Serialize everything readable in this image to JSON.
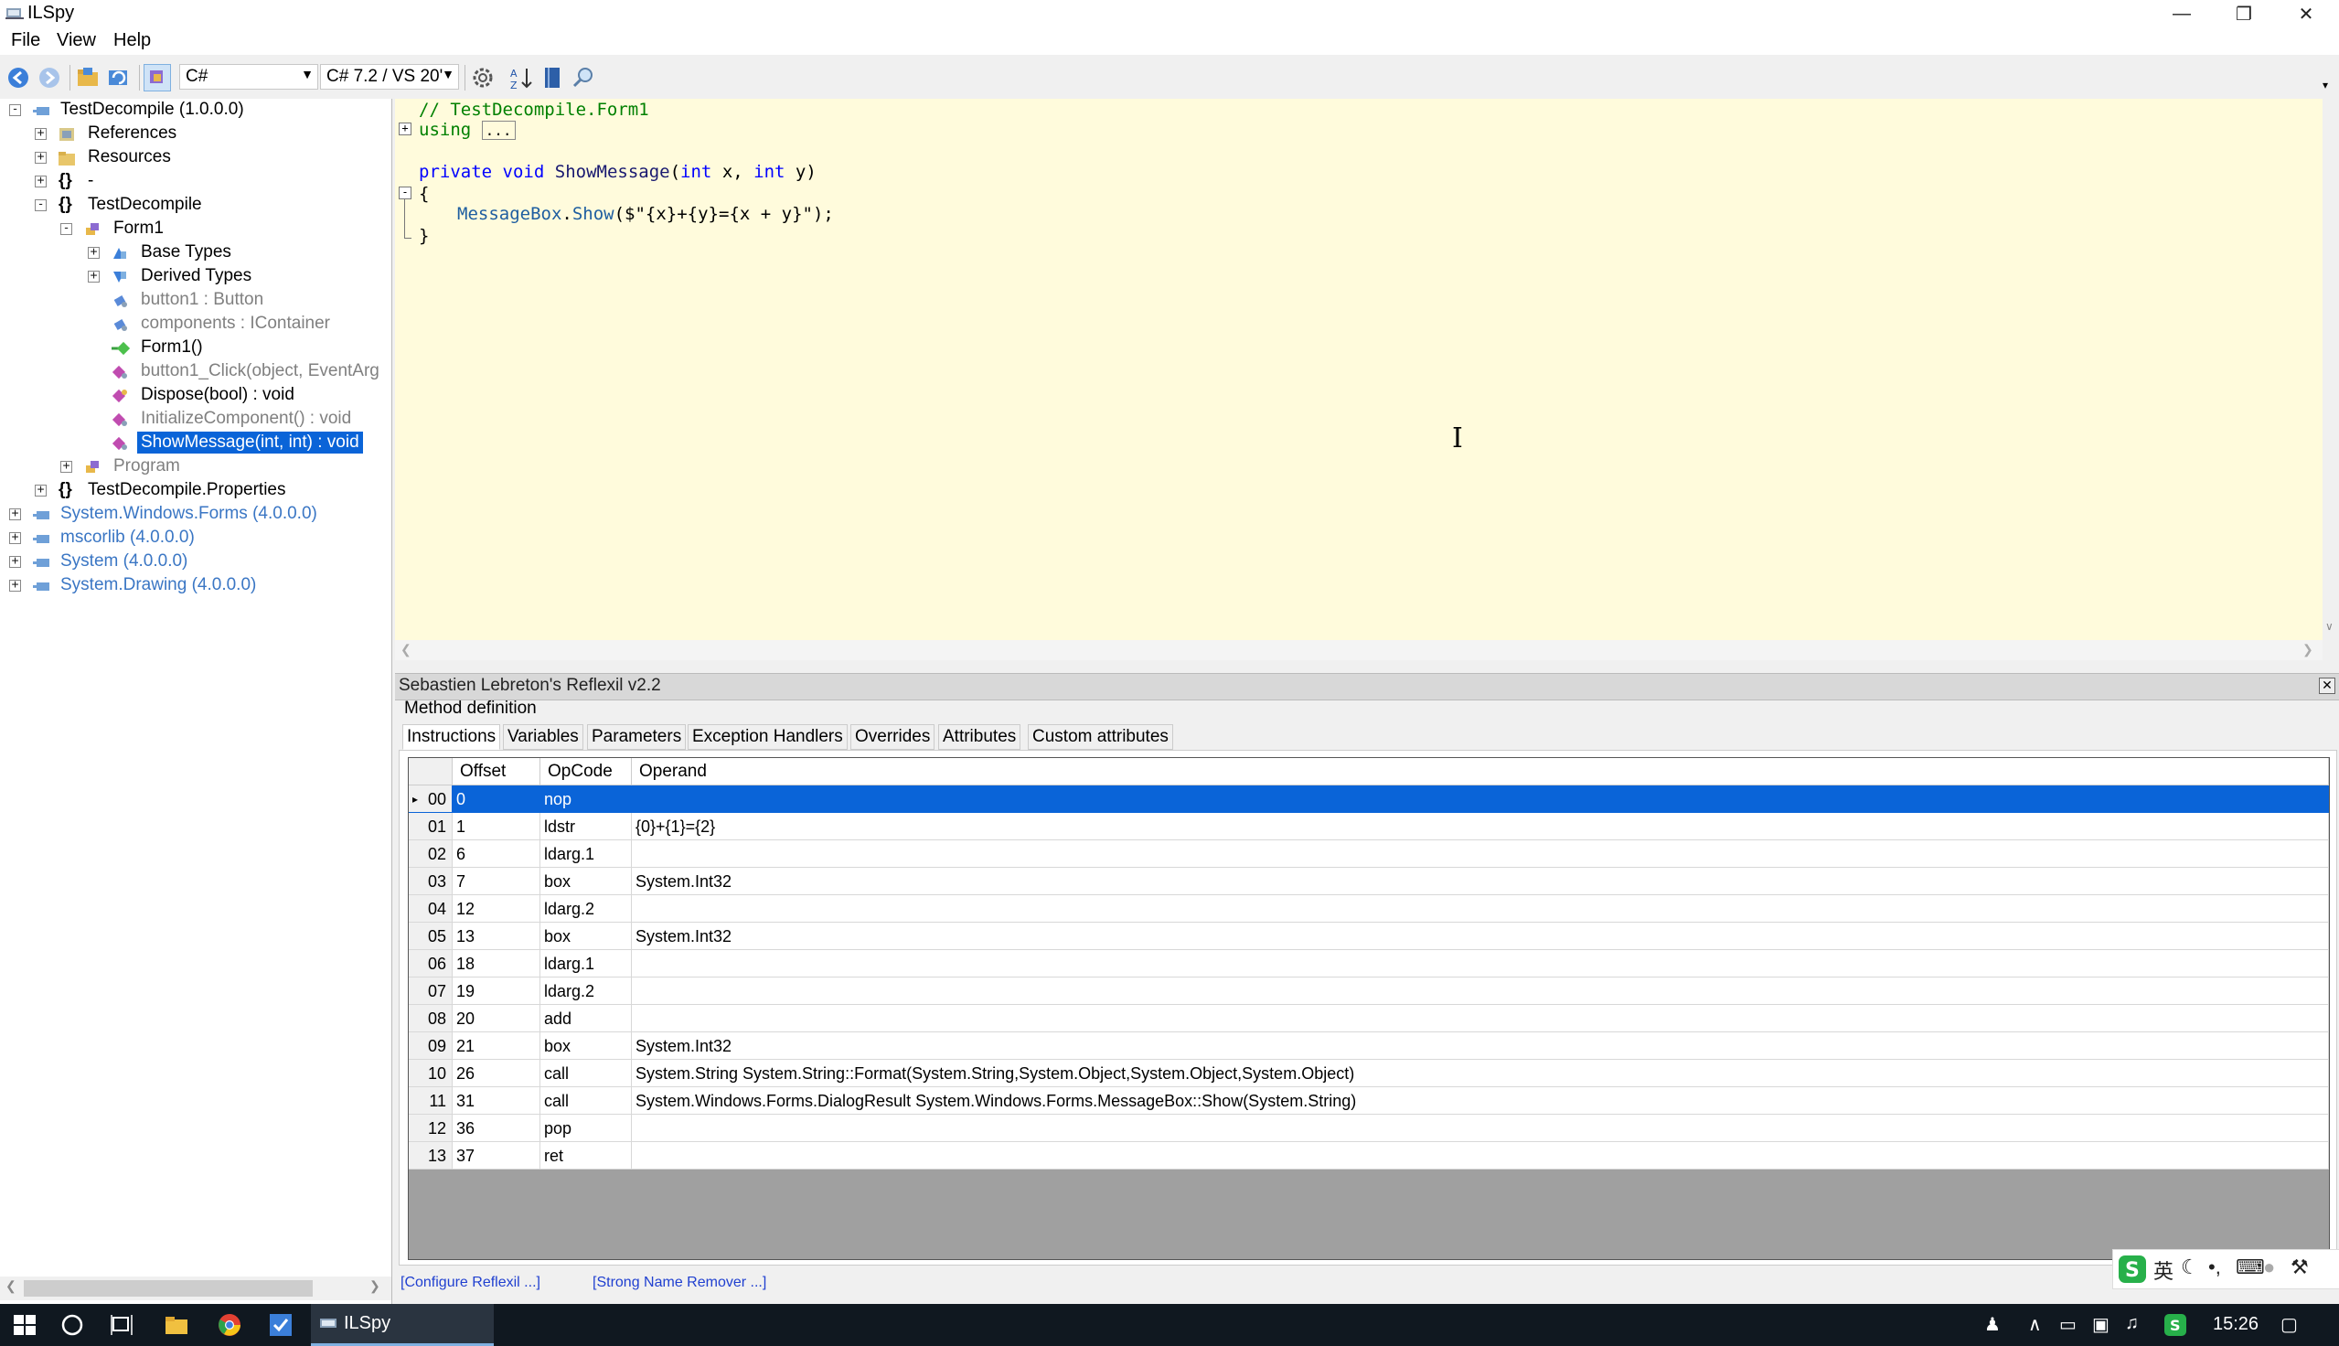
{
  "window": {
    "title": "ILSpy"
  },
  "menu": [
    "File",
    "View",
    "Help"
  ],
  "toolbar": {
    "language": "C#",
    "language_version": "C# 7.2 / VS 20'"
  },
  "tree": [
    {
      "label": "TestDecompile (1.0.0.0)",
      "style": "normal"
    },
    {
      "label": "References",
      "style": "normal"
    },
    {
      "label": "Resources",
      "style": "normal"
    },
    {
      "label": "-",
      "style": "normal"
    },
    {
      "label": "TestDecompile",
      "style": "normal"
    },
    {
      "label": "Form1",
      "style": "normal"
    },
    {
      "label": "Base Types",
      "style": "normal"
    },
    {
      "label": "Derived Types",
      "style": "normal"
    },
    {
      "label": "button1 : Button",
      "style": "grey"
    },
    {
      "label": "components : IContainer",
      "style": "grey"
    },
    {
      "label": "Form1()",
      "style": "normal"
    },
    {
      "label": "button1_Click(object, EventArg",
      "style": "grey"
    },
    {
      "label": "Dispose(bool) : void",
      "style": "normal"
    },
    {
      "label": "InitializeComponent() : void",
      "style": "grey"
    },
    {
      "label": "ShowMessage(int, int) : void",
      "style": "selected"
    },
    {
      "label": "Program",
      "style": "grey"
    },
    {
      "label": "TestDecompile.Properties",
      "style": "normal"
    },
    {
      "label": "System.Windows.Forms (4.0.0.0)",
      "style": "blue"
    },
    {
      "label": "mscorlib (4.0.0.0)",
      "style": "blue"
    },
    {
      "label": "System (4.0.0.0)",
      "style": "blue"
    },
    {
      "label": "System.Drawing (4.0.0.0)",
      "style": "blue"
    }
  ],
  "code": {
    "comment": "// TestDecompile.Form1",
    "using_kw": "using",
    "using_fold": "...",
    "sig_private": "private",
    "sig_void": "void",
    "sig_name": "ShowMessage",
    "sig_open": "(",
    "sig_int1": "int",
    "sig_x": " x, ",
    "sig_int2": "int",
    "sig_y": " y)",
    "brace_open": "{",
    "body_obj": "MessageBox",
    "body_dot": ".",
    "body_show": "Show",
    "body_args": "($\"{x}+{y}={x + y}\");",
    "brace_close": "}"
  },
  "reflexil": {
    "header": "Sebastien Lebreton's Reflexil v2.2",
    "section": "Method definition",
    "tabs": [
      "Instructions",
      "Variables",
      "Parameters",
      "Exception Handlers",
      "Overrides",
      "Attributes",
      "Custom attributes"
    ],
    "columns": [
      "Offset",
      "OpCode",
      "Operand"
    ],
    "rows": [
      {
        "index": "00",
        "offset": "0",
        "opcode": "nop",
        "operand": ""
      },
      {
        "index": "01",
        "offset": "1",
        "opcode": "ldstr",
        "operand": "{0}+{1}={2}"
      },
      {
        "index": "02",
        "offset": "6",
        "opcode": "ldarg.1",
        "operand": ""
      },
      {
        "index": "03",
        "offset": "7",
        "opcode": "box",
        "operand": "System.Int32"
      },
      {
        "index": "04",
        "offset": "12",
        "opcode": "ldarg.2",
        "operand": ""
      },
      {
        "index": "05",
        "offset": "13",
        "opcode": "box",
        "operand": "System.Int32"
      },
      {
        "index": "06",
        "offset": "18",
        "opcode": "ldarg.1",
        "operand": ""
      },
      {
        "index": "07",
        "offset": "19",
        "opcode": "ldarg.2",
        "operand": ""
      },
      {
        "index": "08",
        "offset": "20",
        "opcode": "add",
        "operand": ""
      },
      {
        "index": "09",
        "offset": "21",
        "opcode": "box",
        "operand": "System.Int32"
      },
      {
        "index": "10",
        "offset": "26",
        "opcode": "call",
        "operand": "System.String System.String::Format(System.String,System.Object,System.Object,System.Object)"
      },
      {
        "index": "11",
        "offset": "31",
        "opcode": "call",
        "operand": "System.Windows.Forms.DialogResult System.Windows.Forms.MessageBox::Show(System.String)"
      },
      {
        "index": "12",
        "offset": "36",
        "opcode": "pop",
        "operand": ""
      },
      {
        "index": "13",
        "offset": "37",
        "opcode": "ret",
        "operand": ""
      }
    ],
    "links": [
      "[Configure Reflexil ...]",
      "[Strong Name Remover ...]"
    ]
  },
  "ime": {
    "lang": "英"
  },
  "taskbar": {
    "app_label": "ILSpy",
    "clock": "15:26"
  },
  "colors": {
    "selection": "#0a64d8",
    "code_bg": "#fffbdc",
    "keyword": "#0000ff",
    "comment": "#008000"
  }
}
